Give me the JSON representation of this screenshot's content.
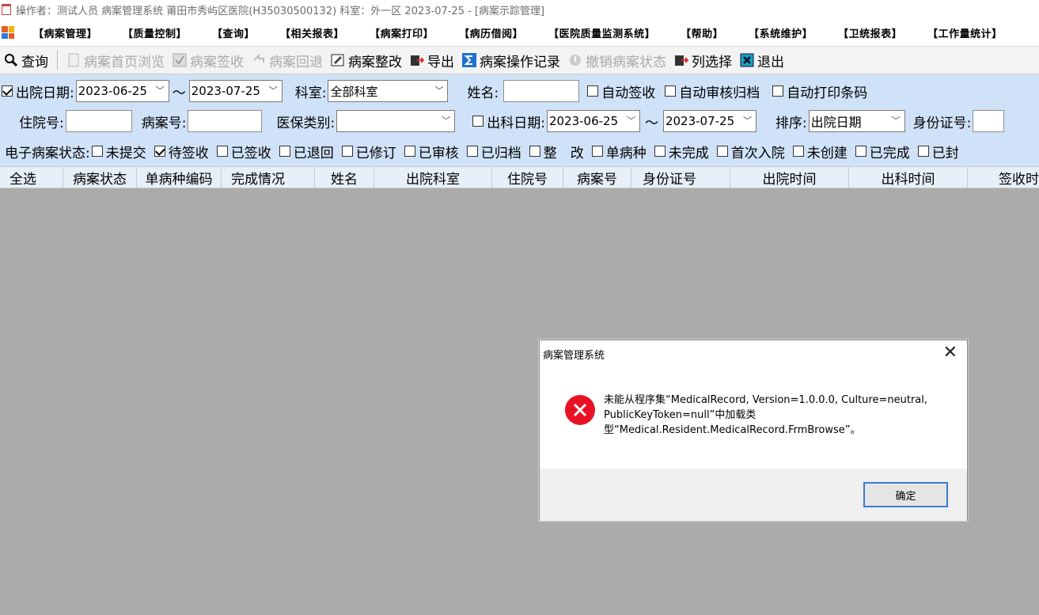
{
  "window": {
    "title": "操作者：测试人员 病案管理系统  莆田市秀屿区医院(H35030500132)  科室：外一区 2023-07-25  - [病案示踪管理]"
  },
  "menu": {
    "items": [
      "【病案管理】",
      "【质量控制】",
      "【查询】",
      "【相关报表】",
      "【病案打印】",
      "【病历借阅】",
      "【医院质量监测系统】",
      "【帮助】",
      "【系统维护】",
      "【卫统报表】",
      "【工作量统计】"
    ]
  },
  "toolbar": {
    "query": "查询",
    "browse_home": "病案首页浏览",
    "sign": "病案签收",
    "return": "病案回退",
    "rectify": "病案整改",
    "export": "导出",
    "op_log": "病案操作记录",
    "revoke_status": "撤销病案状态",
    "column_select": "列选择",
    "exit": "退出"
  },
  "filters": {
    "discharge_date_label": "出院日期:",
    "discharge_date_from": "2023-06-25",
    "tilde": "～",
    "discharge_date_to": "2023-07-25",
    "dept_label": "科室:",
    "dept_value": "全部科室",
    "name_label": "姓名:",
    "auto_sign": "自动签收",
    "auto_audit_archive": "自动审核归档",
    "auto_print_barcode": "自动打印条码",
    "inpatient_no_label": "住院号:",
    "record_no_label": "病案号:",
    "insurance_label": "医保类别:",
    "dept_out_date_label": "出科日期:",
    "dept_out_from": "2023-06-25",
    "dept_out_to": "2023-07-25",
    "sort_label": "排序:",
    "sort_value": "出院日期",
    "id_label": "身份证号:",
    "status_label": "电子病案状态:",
    "statuses": [
      "未提交",
      "待签收",
      "已签收",
      "已退回",
      "已修订",
      "已审核",
      "已归档",
      "整　改",
      "单病种",
      "未完成",
      "首次入院",
      "未创建",
      "已完成",
      "已封"
    ]
  },
  "grid": {
    "columns": [
      "全选",
      "病案状态",
      "单病种编码",
      "完成情况",
      "姓名",
      "出院科室",
      "住院号",
      "病案号",
      "身份证号",
      "出院时间",
      "出科时间",
      "签收时"
    ]
  },
  "dialog": {
    "title": "病案管理系统",
    "message": "未能从程序集“MedicalRecord, Version=1.0.0.0, Culture=neutral, PublicKeyToken=null”中加载类型“Medical.Resident.MedicalRecord.FrmBrowse”。",
    "ok": "确定"
  },
  "colors": {
    "filter_bg": "#cfe2f7",
    "grid_header_bg": "#e7eff9",
    "body_bg": "#ababab",
    "error_red": "#e81123",
    "button_focus": "#3a7bd5"
  }
}
